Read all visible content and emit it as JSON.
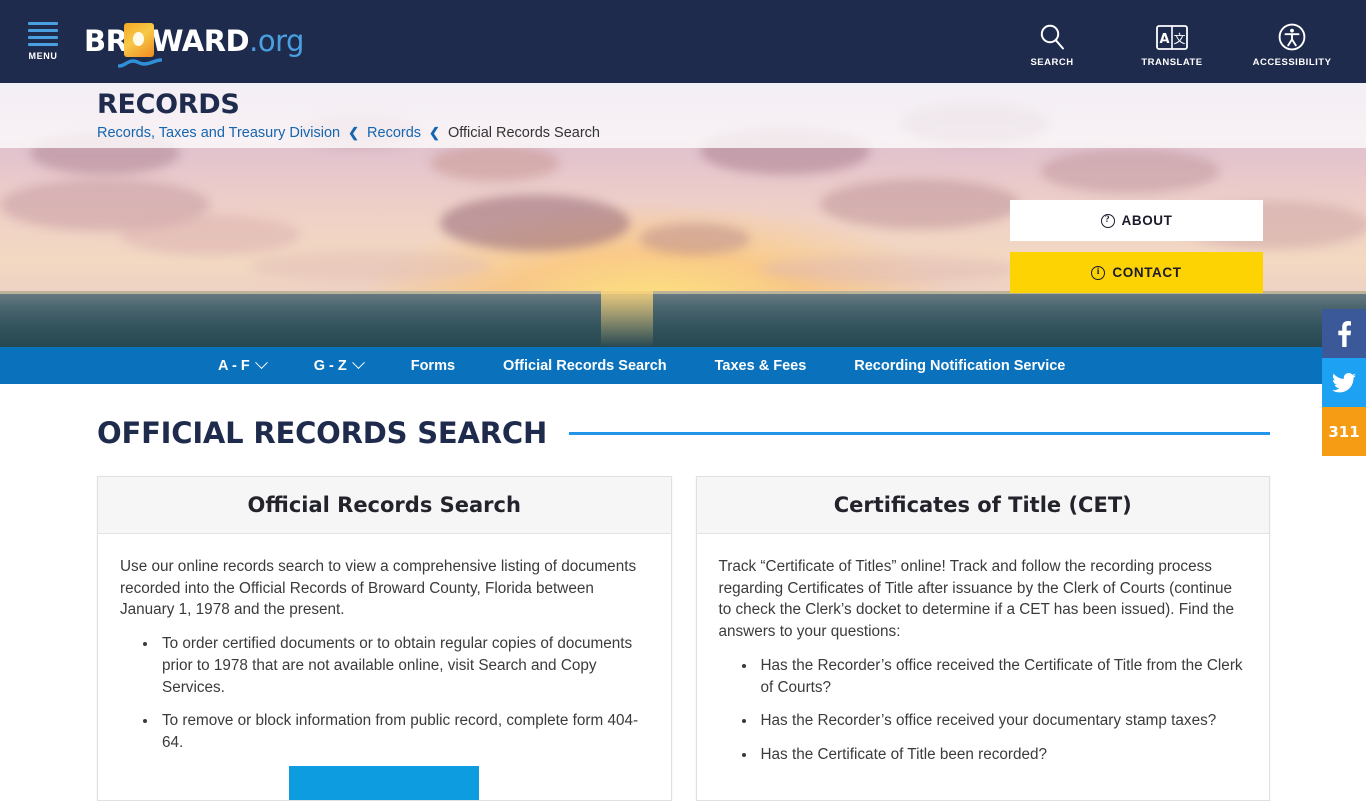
{
  "header": {
    "menu_label": "MENU",
    "logo": {
      "main": "BR",
      "mid": "WARD",
      "suffix": ".org",
      "name": "broward-logo"
    },
    "icons": [
      {
        "name": "search-icon",
        "label": "SEARCH"
      },
      {
        "name": "translate-icon",
        "label": "TRANSLATE"
      },
      {
        "name": "accessibility-icon",
        "label": "ACCESSIBILITY"
      }
    ]
  },
  "hero": {
    "eyebrow": "RECORDS",
    "breadcrumb": {
      "items": [
        "Records, Taxes and Treasury Division",
        "Records"
      ],
      "current": "Official Records Search",
      "separator": "❮"
    },
    "buttons": [
      {
        "label": "ABOUT",
        "icon": "?",
        "name": "about-button"
      },
      {
        "label": "CONTACT",
        "icon": "i",
        "name": "contact-button"
      }
    ]
  },
  "subnav": {
    "items": [
      {
        "label": "A - F",
        "caret": true,
        "name": "nav-item-a-f"
      },
      {
        "label": "G - Z",
        "caret": true,
        "name": "nav-item-g-z"
      },
      {
        "label": "Forms",
        "caret": false,
        "name": "nav-item-forms"
      },
      {
        "label": "Official Records Search",
        "caret": false,
        "name": "nav-item-official-records-search"
      },
      {
        "label": "Taxes & Fees",
        "caret": false,
        "name": "nav-item-taxes-fees"
      },
      {
        "label": "Recording Notification Service",
        "caret": false,
        "name": "nav-item-recording-notification-service"
      }
    ]
  },
  "main": {
    "page_title": "OFFICIAL RECORDS SEARCH",
    "cards": [
      {
        "title": "Official Records Search",
        "paragraph": "Use our online records search to view a comprehensive listing of documents recorded into the Official Records of Broward County, Florida between January 1, 1978 and the present.",
        "bullets": [
          "To order certified documents or to obtain regular copies of documents prior to 1978 that are not available online, visit Search and Copy Services.",
          "To remove or block information from public record, complete form 404-64."
        ],
        "cta": ""
      },
      {
        "title": "Certificates of Title (CET)",
        "paragraph": "Track “Certificate of Titles” online! Track and follow the recording process regarding Certificates of Title after issuance by the Clerk of Courts (continue to check the Clerk’s docket to determine if a CET has been issued). Find the answers to your questions:",
        "bullets": [
          "Has the Recorder’s office received the Certificate of Title from the Clerk of Courts?",
          "Has the Recorder’s office received your documentary stamp taxes?",
          "Has the Certificate of Title been recorded?"
        ]
      }
    ]
  },
  "social": [
    {
      "name": "facebook-button",
      "label": "f",
      "color": "#3b5998"
    },
    {
      "name": "twitter-button",
      "label": "",
      "color": "#1da1f2"
    },
    {
      "name": "n311-button",
      "label": "311",
      "color": "#f59b14"
    }
  ],
  "colors": {
    "header_bg": "#1f2b4d",
    "nav_bg": "#0a72bd",
    "accent_blue": "#2196e8",
    "contact_yellow": "#fdd304",
    "cta_blue": "#0d9ce0"
  }
}
